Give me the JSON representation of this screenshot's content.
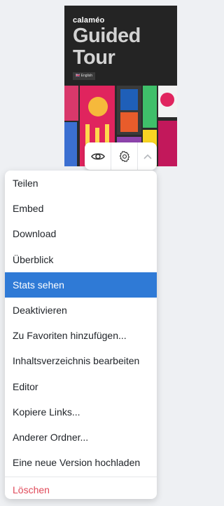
{
  "cover": {
    "brand": "calaméo",
    "title_line1": "Guided",
    "title_line2": "Tour",
    "language_badge": "English"
  },
  "action_bar": {
    "view_icon": "eye-icon",
    "settings_icon": "gear-icon",
    "collapse_icon": "chevron-up-icon"
  },
  "menu": {
    "items": [
      {
        "label": "Teilen"
      },
      {
        "label": "Embed"
      },
      {
        "label": "Download"
      },
      {
        "label": "Überblick"
      },
      {
        "label": "Stats sehen",
        "active": true
      },
      {
        "label": "Deaktivieren"
      },
      {
        "label": "Zu Favoriten hinzufügen..."
      },
      {
        "label": "Inhaltsverzeichnis bearbeiten"
      },
      {
        "label": "Editor"
      },
      {
        "label": "Kopiere Links..."
      },
      {
        "label": "Anderer Ordner..."
      },
      {
        "label": "Eine neue Version hochladen"
      }
    ],
    "delete_label": "Löschen"
  },
  "colors": {
    "active_bg": "#2f7ad6",
    "danger": "#e04a5a",
    "page_bg": "#eef0f3"
  }
}
